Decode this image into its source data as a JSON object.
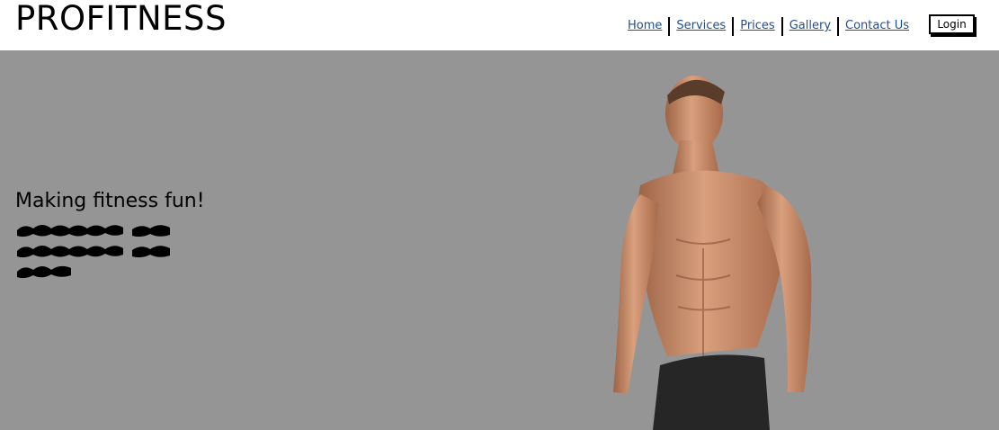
{
  "header": {
    "brand": "PROFITNESS",
    "nav": [
      {
        "label": "Home"
      },
      {
        "label": "Services"
      },
      {
        "label": "Prices"
      },
      {
        "label": "Gallery"
      },
      {
        "label": "Contact Us"
      }
    ],
    "login_label": "Login"
  },
  "hero": {
    "tagline": "Making fitness fun!",
    "background_color": "#959595"
  },
  "colors": {
    "nav_link": "#1f4f8f",
    "text": "#000000"
  }
}
